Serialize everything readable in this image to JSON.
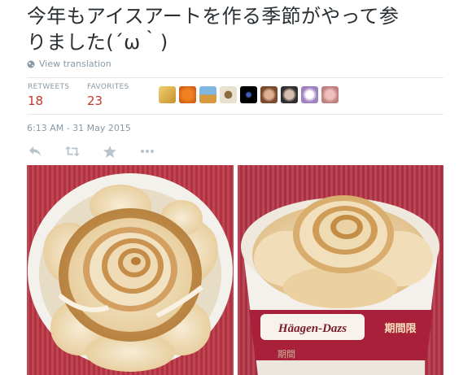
{
  "tweet": {
    "line1": "今年もアイスアートを作る季節がやって参",
    "line2": "りました(´ω｀)"
  },
  "translate_label": "View translation",
  "stats": {
    "retweets_label": "RETWEETS",
    "retweets_count": "18",
    "favorites_label": "FAVORITES",
    "favorites_count": "23"
  },
  "timestamp": "6:13 AM - 31 May 2015",
  "actions": [
    "reply-icon",
    "retweet-icon",
    "favorite-icon",
    "more-icon"
  ],
  "favoriter_avatars": 9,
  "photos": {
    "right_cup_brand": "Häagen-Dazs",
    "right_cup_label_1": "期間限",
    "right_cup_label_2": "期間"
  },
  "colors": {
    "text": "#292f33",
    "muted": "#8899a6",
    "count": "#c0392b",
    "divider": "#e1e8ed"
  }
}
